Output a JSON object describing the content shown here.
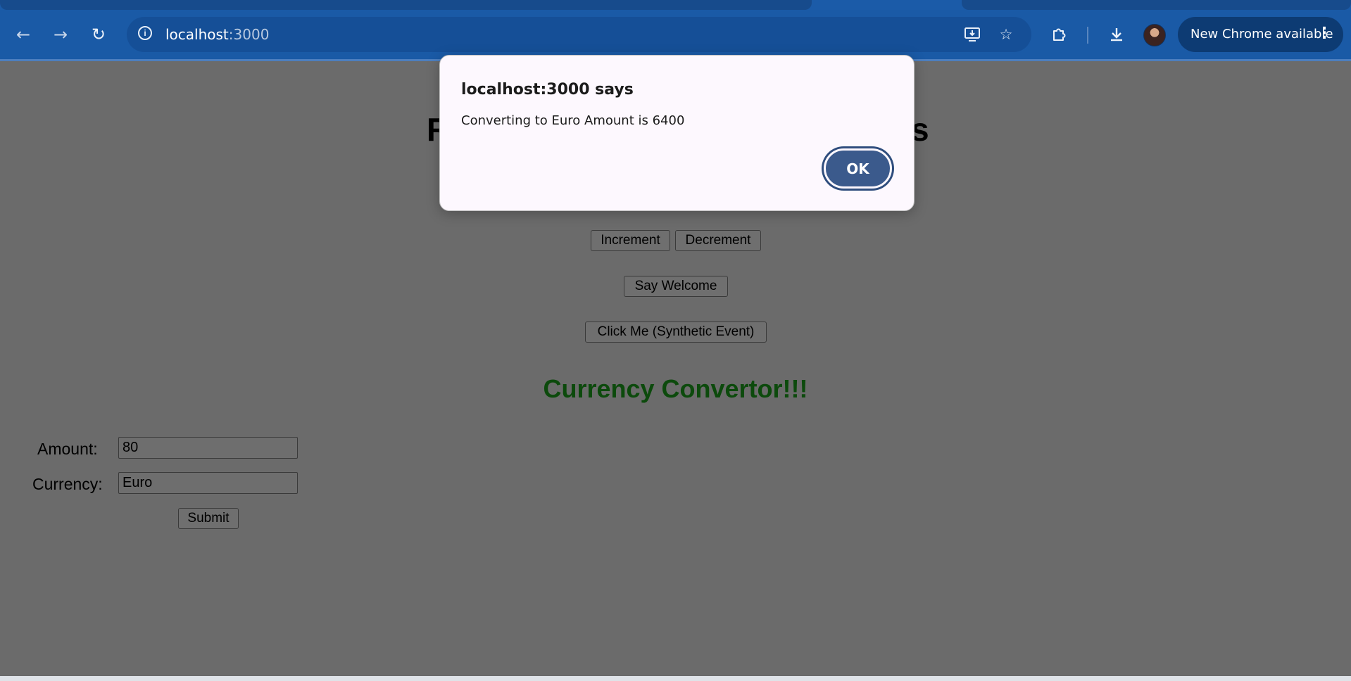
{
  "browser": {
    "url_host": "localhost",
    "url_port": ":3000",
    "update_label": "New Chrome available",
    "menu_dots": "⋮"
  },
  "icons": {
    "back": "back-arrow-icon",
    "forward": "forward-arrow-icon",
    "reload": "reload-icon",
    "site_info": "info-icon",
    "install": "install-app-icon",
    "bookmark": "star-icon",
    "extensions": "puzzle-icon",
    "downloads": "download-icon",
    "profile": "avatar"
  },
  "page": {
    "heading_left": "R",
    "heading_right": "s",
    "buttons": {
      "increment": "Increment",
      "decrement": "Decrement",
      "say_welcome": "Say Welcome",
      "synthetic": "Click Me (Synthetic Event)",
      "submit": "Submit"
    },
    "currency_title": "Currency Convertor!!!",
    "form": {
      "amount_label": "Amount:",
      "amount_value": "80",
      "currency_label": "Currency:",
      "currency_value": "Euro"
    }
  },
  "dialog": {
    "title": "localhost:3000 says",
    "message": "Converting to Euro Amount is 6400",
    "ok_label": "OK"
  },
  "colors": {
    "chrome_blue": "#1a5aa6",
    "overlay_gray": "#6b6b6b",
    "title_green": "#0c4a0c",
    "ok_button": "#3b5a8c"
  }
}
